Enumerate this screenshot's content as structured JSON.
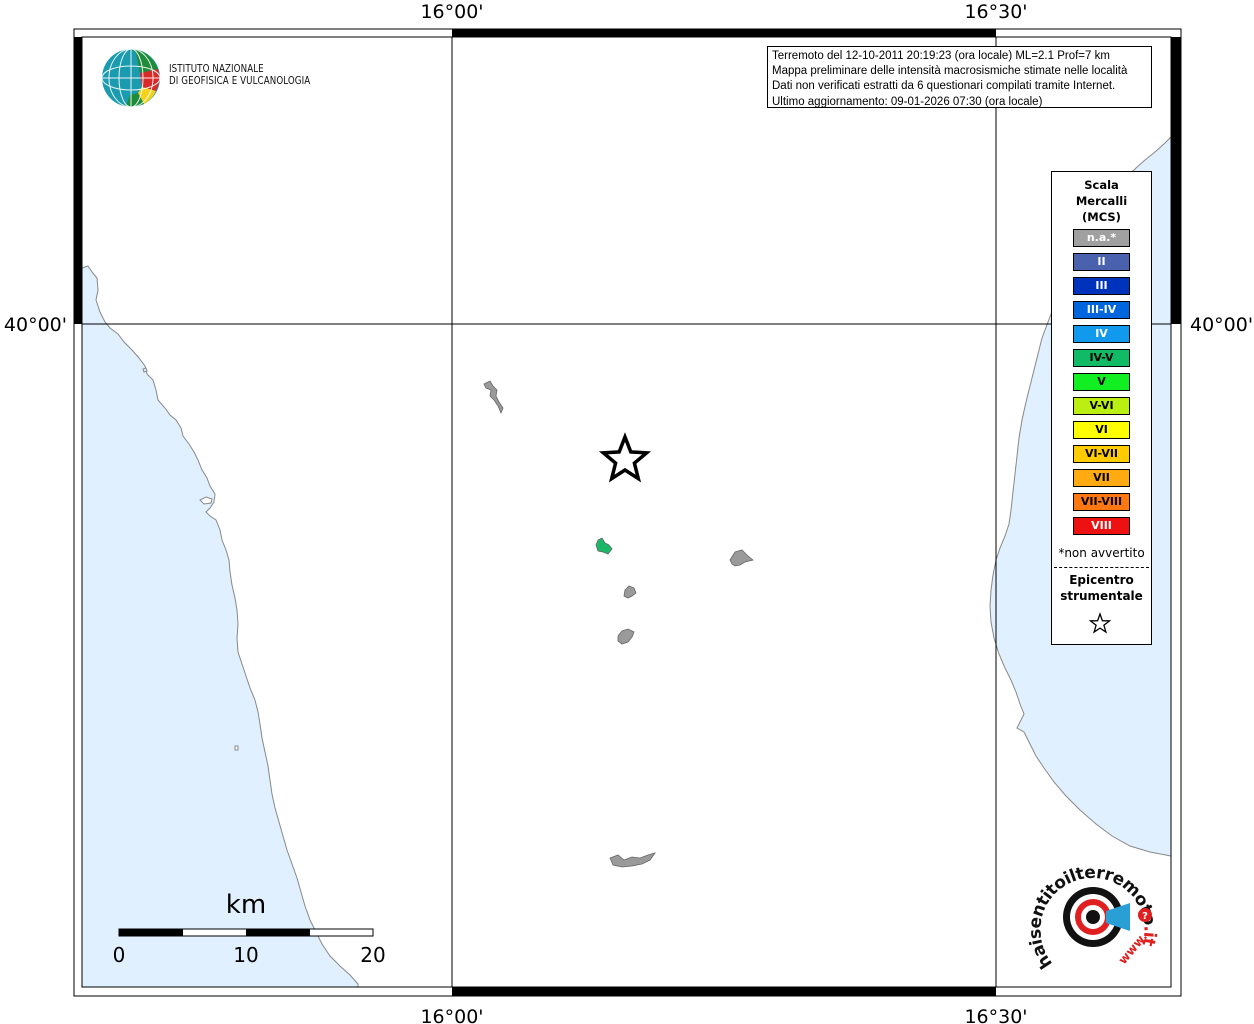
{
  "header": {
    "info_lines": [
      "Terremoto del 12-10-2011 20:19:23 (ora locale) ML=2.1 Prof=7 km",
      "Mappa preliminare delle intensità macrosismiche stimate nelle località",
      "Dati non verificati estratti da 6 questionari compilati tramite Internet.",
      "Ultimo aggiornamento: 09-01-2026 07:30 (ora locale)"
    ]
  },
  "logo": {
    "line1": "ISTITUTO NAZIONALE",
    "line2": "DI GEOFISICA E VULCANOLOGIA"
  },
  "map": {
    "lon_labels": [
      "16°00'",
      "16°30'"
    ],
    "lat_labels": [
      "40°00'"
    ],
    "colors": {
      "sea": "#e0f0ff",
      "coast": "#888888",
      "frame": "#000000",
      "grid": "#000000"
    }
  },
  "localities": [
    {
      "name_hidden": "",
      "intensity": "n.a.",
      "color": "#9a9a9a"
    },
    {
      "name_hidden": "",
      "intensity": "IV-V",
      "color": "#1db76a"
    }
  ],
  "epicenter": {
    "symbol": "star-icon"
  },
  "scale_bar": {
    "unit": "km",
    "ticks": [
      "0",
      "10",
      "20"
    ]
  },
  "legend": {
    "title_lines": [
      "Scala",
      "Mercalli",
      "(MCS)"
    ],
    "items": [
      {
        "label": "n.a.*",
        "color": "#a0a0a0",
        "text_color": "#ffffff"
      },
      {
        "label": "II",
        "color": "#4a62ad",
        "text_color": "#ffffff"
      },
      {
        "label": "III",
        "color": "#0033bb",
        "text_color": "#ffffff"
      },
      {
        "label": "III-IV",
        "color": "#0066dd",
        "text_color": "#ffffff"
      },
      {
        "label": "IV",
        "color": "#1199ee",
        "text_color": "#ffffff"
      },
      {
        "label": "IV-V",
        "color": "#11bb66",
        "text_color": "#000000"
      },
      {
        "label": "V",
        "color": "#11ee22",
        "text_color": "#000000"
      },
      {
        "label": "V-VI",
        "color": "#bbee11",
        "text_color": "#000000"
      },
      {
        "label": "VI",
        "color": "#ffff00",
        "text_color": "#000000"
      },
      {
        "label": "VI-VII",
        "color": "#ffcc00",
        "text_color": "#000000"
      },
      {
        "label": "VII",
        "color": "#ffaa11",
        "text_color": "#000000"
      },
      {
        "label": "VII-VIII",
        "color": "#ff7711",
        "text_color": "#000000"
      },
      {
        "label": "VIII",
        "color": "#ee1111",
        "text_color": "#ffffff"
      }
    ],
    "note": "*non avvertito",
    "epicenter_lines": [
      "Epicentro",
      "strumentale"
    ]
  },
  "watermark": {
    "text_main": "haisentitoilterremoto",
    "text_tld": ".it",
    "text_www": "www."
  }
}
